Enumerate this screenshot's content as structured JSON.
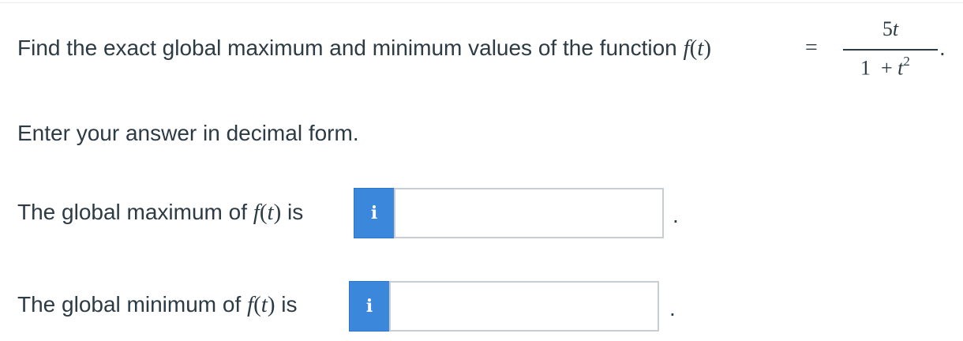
{
  "question": {
    "text": "Find the exact global maximum and minimum values of the function",
    "function_name": "f",
    "variable": "t",
    "equals": "=",
    "fraction": {
      "numerator_coef": "5",
      "numerator_var": "t",
      "denominator_const": "1",
      "plus": "+",
      "denominator_var": "t",
      "denominator_exp": "2"
    },
    "end_punct": "."
  },
  "instruction": "Enter your answer in decimal form.",
  "answers": [
    {
      "label": "The global maximum of",
      "suffix": "is",
      "info_icon": "i",
      "value": "",
      "trailing": "."
    },
    {
      "label": "The global minimum of",
      "suffix": "is",
      "info_icon": "i",
      "value": "",
      "trailing": "."
    }
  ]
}
